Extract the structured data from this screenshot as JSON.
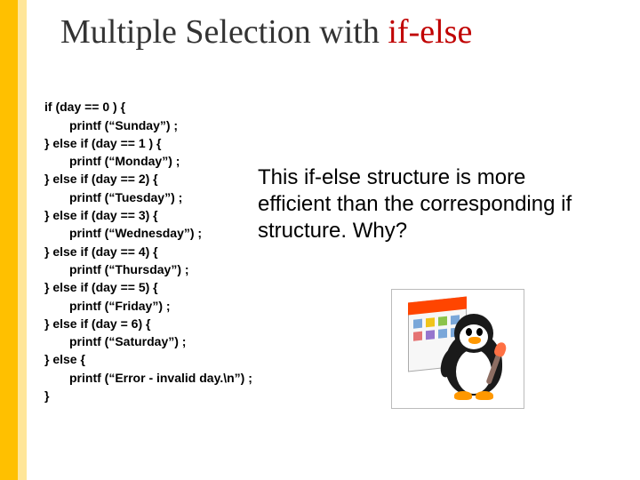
{
  "title": {
    "prefix": "Multiple Selection with ",
    "keyword": "if-else"
  },
  "code": {
    "l1": "if (day == 0 ) {",
    "l2": "printf (“Sunday”) ;",
    "l3": "} else if (day == 1 ) {",
    "l4": "printf (“Monday”) ;",
    "l5": "} else if (day == 2) {",
    "l6": "printf (“Tuesday”) ;",
    "l7": "} else if (day == 3) {",
    "l8": "printf (“Wednesday”) ;",
    "l9": "} else if (day == 4) {",
    "l10": "printf (“Thursday”) ;",
    "l11": "} else if (day == 5) {",
    "l12": "printf (“Friday”) ;",
    "l13": "} else if (day = 6) {",
    "l14": "printf (“Saturday”) ;",
    "l15": "} else {",
    "l16": "printf (“Error - invalid day.\\n”) ;",
    "l17": "}"
  },
  "explanation": "This if-else structure is more efficient than the corresponding if structure.  Why?",
  "image_alt": "penguin-painter-clipart"
}
